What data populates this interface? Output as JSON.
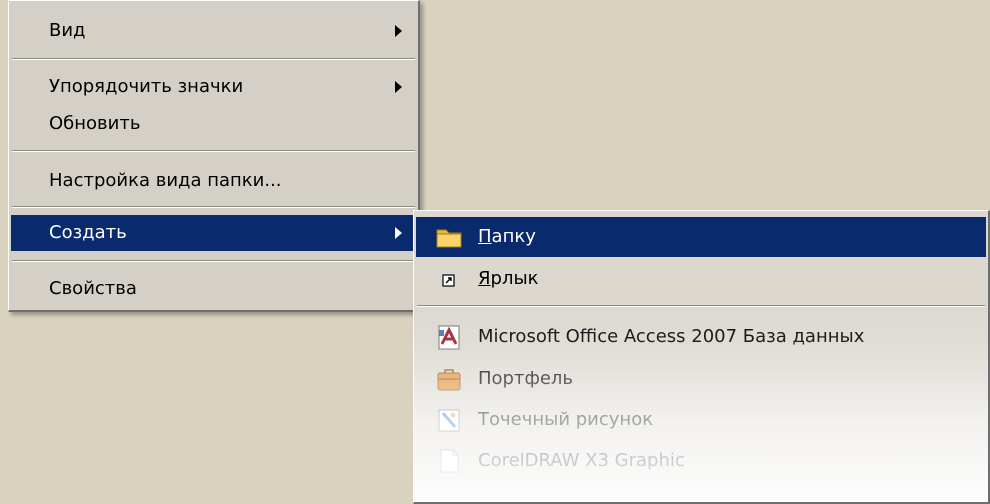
{
  "main_menu": {
    "items": [
      {
        "label": "Вид"
      },
      {
        "label": "Упорядочить значки"
      },
      {
        "label": "Обновить"
      },
      {
        "label": "Настройка вида папки..."
      },
      {
        "label": "Создать"
      },
      {
        "label": "Свойства"
      }
    ]
  },
  "sub_menu": {
    "items": [
      {
        "first": "П",
        "rest": "апку"
      },
      {
        "first": "Я",
        "rest": "рлык"
      },
      {
        "label": "Microsoft Office Access 2007 База данных"
      },
      {
        "label": "Портфель"
      },
      {
        "label": "Точечный рисунок"
      },
      {
        "label": "CorelDRAW X3 Graphic"
      }
    ]
  },
  "colors": {
    "desktop": "#d8d2bf",
    "menu_bg": "#d4d0c8",
    "highlight": "#0a2a6e",
    "highlight_text": "#ffffff"
  },
  "icons": {
    "folder": "folder-icon",
    "shortcut": "shortcut-icon",
    "access": "access-database-icon",
    "briefcase": "briefcase-icon",
    "bitmap": "bitmap-image-icon",
    "corel": "coreldraw-icon"
  }
}
